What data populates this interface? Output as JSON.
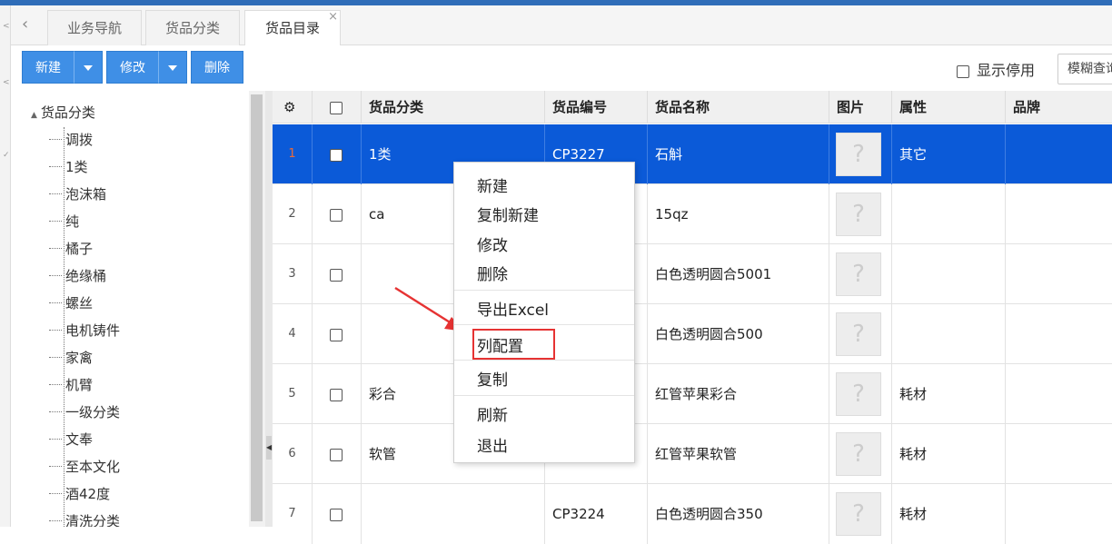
{
  "tabs": {
    "nav": "业务导航",
    "category": "货品分类",
    "catalog": "货品目录",
    "close": "×"
  },
  "toolbar": {
    "new": "新建",
    "edit": "修改",
    "delete": "删除",
    "show_disabled": "显示停用",
    "search_placeholder": "模糊查询"
  },
  "tree": {
    "root": "货品分类",
    "items": [
      "调拨",
      "1类",
      "泡沫箱",
      "纯",
      "橘子",
      "绝缘桶",
      "螺丝",
      "电机铸件",
      "家禽",
      "机臂",
      "一级分类",
      "文奉",
      "至本文化",
      "酒42度",
      "清洗分类"
    ]
  },
  "grid": {
    "headers": {
      "category": "货品分类",
      "code": "货品编号",
      "name": "货品名称",
      "image": "图片",
      "attr": "属性",
      "brand": "品牌"
    },
    "rows": [
      {
        "num": "1",
        "category": "1类",
        "code": "CP3227",
        "name": "石斛",
        "attr": "其它"
      },
      {
        "num": "2",
        "category": "ca",
        "code": "",
        "name": "15qz",
        "attr": ""
      },
      {
        "num": "3",
        "category": "",
        "code": "",
        "name": "白色透明圆合5001",
        "attr": ""
      },
      {
        "num": "4",
        "category": "",
        "code": "",
        "name": "白色透明圆合500",
        "attr": ""
      },
      {
        "num": "5",
        "category": "彩合",
        "code": "",
        "name": "红管苹果彩合",
        "attr": "耗材"
      },
      {
        "num": "6",
        "category": "软管",
        "code": "",
        "name": "红管苹果软管",
        "attr": "耗材"
      },
      {
        "num": "7",
        "category": "",
        "code": "CP3224",
        "name": "白色透明圆合350",
        "attr": "耗材"
      }
    ],
    "image_placeholder": "?"
  },
  "context_menu": {
    "new": "新建",
    "copy_new": "复制新建",
    "edit": "修改",
    "delete": "删除",
    "export": "导出Excel",
    "columns": "列配置",
    "copy": "复制",
    "refresh": "刷新",
    "exit": "退出"
  },
  "colors": {
    "accent": "#3f8fe6",
    "selected_row": "#0b5ad8",
    "highlight": "#e63333"
  }
}
